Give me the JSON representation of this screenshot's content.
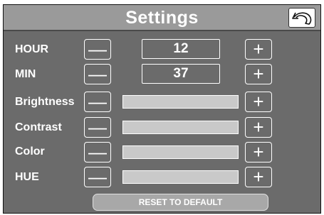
{
  "header": {
    "title": "Settings",
    "back_icon": "back-arrow-icon"
  },
  "controls": {
    "minus_symbol": "—",
    "plus_symbol": "+"
  },
  "rows": [
    {
      "label": "HOUR",
      "value": "12"
    },
    {
      "label": "MIN",
      "value": "37"
    },
    {
      "label": "Brightness"
    },
    {
      "label": "Contrast"
    },
    {
      "label": "Color"
    },
    {
      "label": "HUE"
    }
  ],
  "reset_label": "RESET TO DEFAULT",
  "colors": {
    "panel": "#6b6b6b",
    "header": "#9a9a9a",
    "bar": "#c9c9c9",
    "text": "#ffffff"
  }
}
